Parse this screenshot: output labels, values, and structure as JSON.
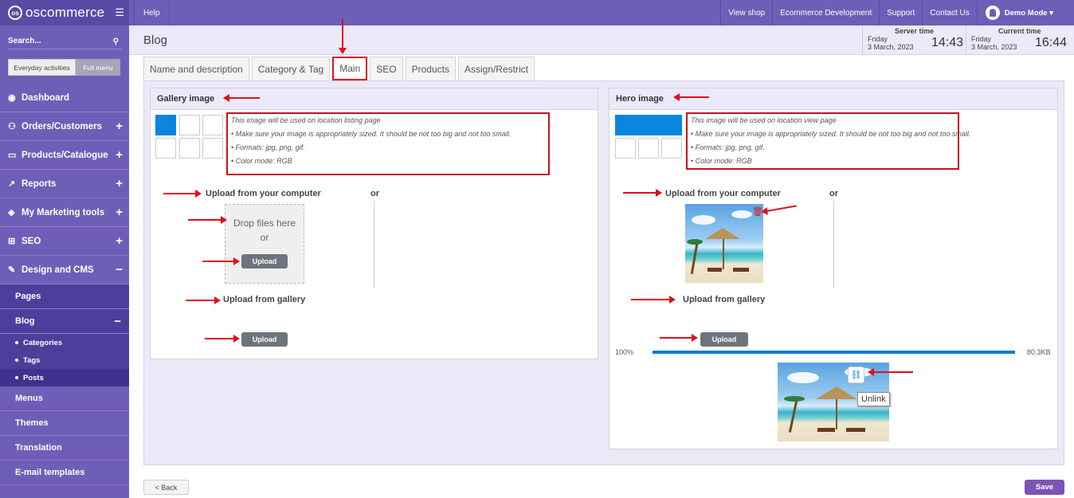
{
  "app": {
    "logo_text": "oscommerce",
    "help": "Help"
  },
  "topnav": {
    "links": [
      "View shop",
      "Ecommerce Development",
      "Support",
      "Contact Us"
    ],
    "user": "Demo Mode ▾"
  },
  "sidebar": {
    "search_label": "Search...",
    "toggle": {
      "everyday": "Everyday activities",
      "full": "Full menu"
    },
    "items": [
      {
        "label": "Dashboard"
      },
      {
        "label": "Orders/Customers",
        "expand": "+"
      },
      {
        "label": "Products/Catalogue",
        "expand": "+"
      },
      {
        "label": "Reports",
        "expand": "+"
      },
      {
        "label": "My Marketing tools",
        "expand": "+"
      },
      {
        "label": "SEO",
        "expand": "+"
      },
      {
        "label": "Design and CMS",
        "expand": "−"
      }
    ],
    "design_sub": [
      "Pages",
      "Blog"
    ],
    "blog_collapse": "−",
    "blog_sub": [
      "Categories",
      "Tags",
      "Posts"
    ],
    "more": [
      "Menus",
      "Themes",
      "Translation",
      "E-mail templates"
    ]
  },
  "header": {
    "title": "Blog",
    "server": {
      "label": "Server time",
      "day": "Friday",
      "date": "3 March, 2023",
      "time": "14:43"
    },
    "current": {
      "label": "Current time",
      "day": "Friday",
      "date": "3 March, 2023",
      "time": "16:44"
    }
  },
  "tabs": [
    "Name and description",
    "Category & Tag",
    "Main",
    "SEO",
    "Products",
    "Assign/Restrict"
  ],
  "gallery": {
    "title": "Gallery image",
    "info": [
      "This image will be used on location listing page",
      "• Make sure your image is appropriately sized. It should be not too big and not too small.",
      "• Formats: jpg, png, gif.",
      "• Color mode: RGB"
    ],
    "upload_computer": "Upload from your computer",
    "or": "or",
    "drop1": "Drop files here",
    "drop2": "or",
    "upload_btn": "Upload",
    "upload_gallery": "Upload from gallery",
    "gallery_btn": "Upload"
  },
  "hero": {
    "title": "Hero image",
    "info": [
      "This image will be used on location view page",
      "• Make sure your image is appropriately sized. It should be not too big and not too small.",
      "• Formats: jpg, png, gif.",
      "• Color mode: RGB"
    ],
    "upload_computer": "Upload from your computer",
    "or": "or",
    "upload_gallery": "Upload from gallery",
    "gallery_btn": "Upload",
    "progress_pct": "100%",
    "progress_value": 1.0,
    "file_size": "80.3KB",
    "unlink_tooltip": "Unlink"
  },
  "footer": {
    "back": "< Back",
    "save": "Save"
  },
  "colors": {
    "sidebar": "#6f5eb8",
    "accent_blue": "#0a85e0",
    "annotation_red": "#e0101b",
    "save": "#7c55b7"
  }
}
